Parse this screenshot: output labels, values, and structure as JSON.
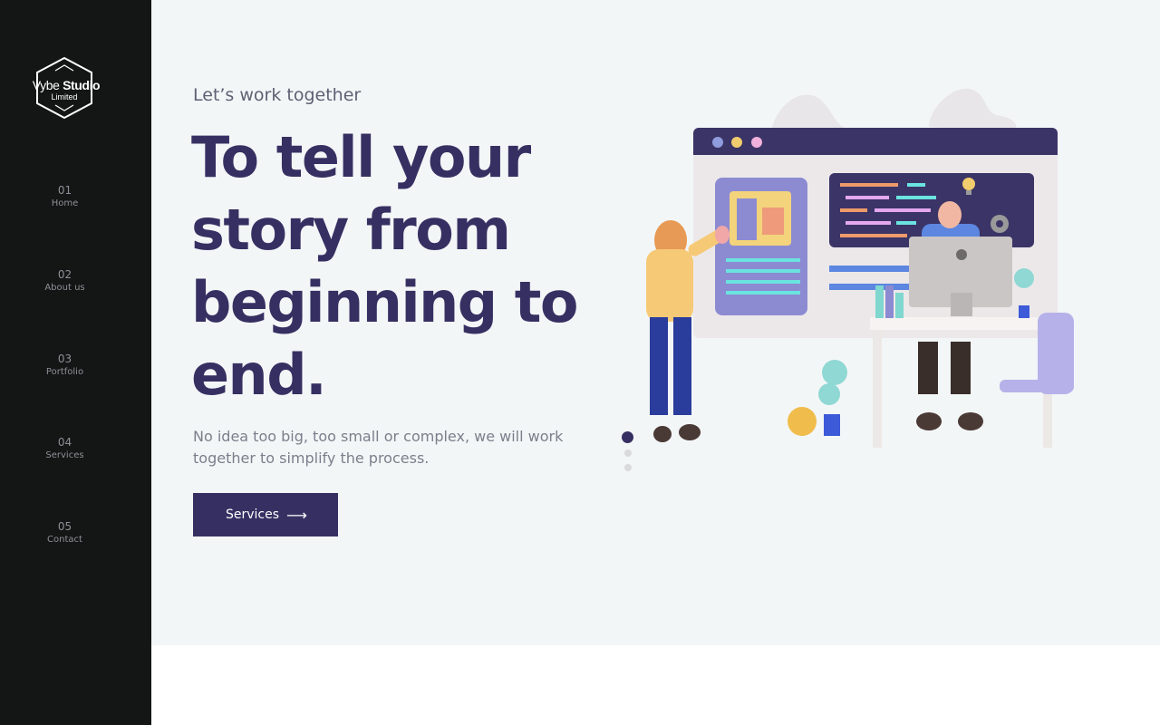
{
  "brand": {
    "name_light": "Vybe",
    "name_bold": "Studio",
    "subtitle": "Limited"
  },
  "nav": [
    {
      "number": "01",
      "label": "Home"
    },
    {
      "number": "02",
      "label": "About us"
    },
    {
      "number": "03",
      "label": "Portfolio"
    },
    {
      "number": "04",
      "label": "Services"
    },
    {
      "number": "05",
      "label": "Contact"
    }
  ],
  "hero": {
    "eyebrow": "Let’s work together",
    "headline_lines": [
      "To tell your",
      "story from",
      "beginning to",
      "end."
    ],
    "description": "No idea too big, too small or complex, we will work together to simplify the process.",
    "cta_label": "Services",
    "cta_icon": "long-arrow-right-icon"
  },
  "slider": {
    "count": 3,
    "active_index": 0
  },
  "colors": {
    "sidebar_bg": "#141515",
    "hero_bg": "#f3f6f7",
    "accent": "#363062",
    "nav_text": "#8d9096",
    "body_text": "#7b7f8b"
  }
}
